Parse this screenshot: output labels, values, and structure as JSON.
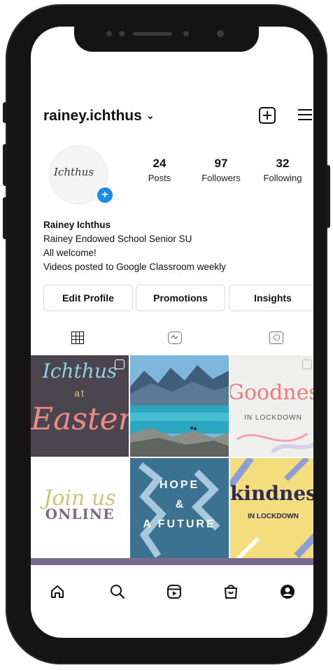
{
  "profile": {
    "username": "rainey.ichthus",
    "avatar_text": "Ichthus",
    "stats": [
      {
        "value": "24",
        "label": "Posts"
      },
      {
        "value": "97",
        "label": "Followers"
      },
      {
        "value": "32",
        "label": "Following"
      }
    ],
    "bio": {
      "name": "Rainey Ichthus",
      "lines": [
        "Rainey Endowed School Senior SU",
        "All welcome!",
        "Videos posted to Google Classroom weekly"
      ]
    },
    "buttons": {
      "edit": "Edit Profile",
      "promotions": "Promotions",
      "insights": "Insights"
    }
  },
  "posts": [
    {
      "line1": "Ichthus",
      "line2": "at",
      "line3": "Easter"
    },
    {
      "image": "mountain lake"
    },
    {
      "line1": "Goodnes",
      "line2": "IN LOCKDOWN"
    },
    {
      "line1": "Join us",
      "line2": "ONLINE"
    },
    {
      "line1": "HOPE",
      "line2": "&",
      "line3": "A FUTURE"
    },
    {
      "line1": "kindnes",
      "line2": "IN LOCKDOWN"
    }
  ],
  "icons": {
    "header": [
      "chevron-down-icon",
      "new-post-icon",
      "menu-icon"
    ],
    "tabs": [
      "grid-icon",
      "reels-icon",
      "tagged-icon"
    ],
    "nav": [
      "home-icon",
      "search-icon",
      "reels-icon",
      "shop-icon",
      "profile-icon"
    ]
  },
  "colors": {
    "accent": "#1a8cf0",
    "text": "#111111",
    "border": "#dbdbdb"
  }
}
